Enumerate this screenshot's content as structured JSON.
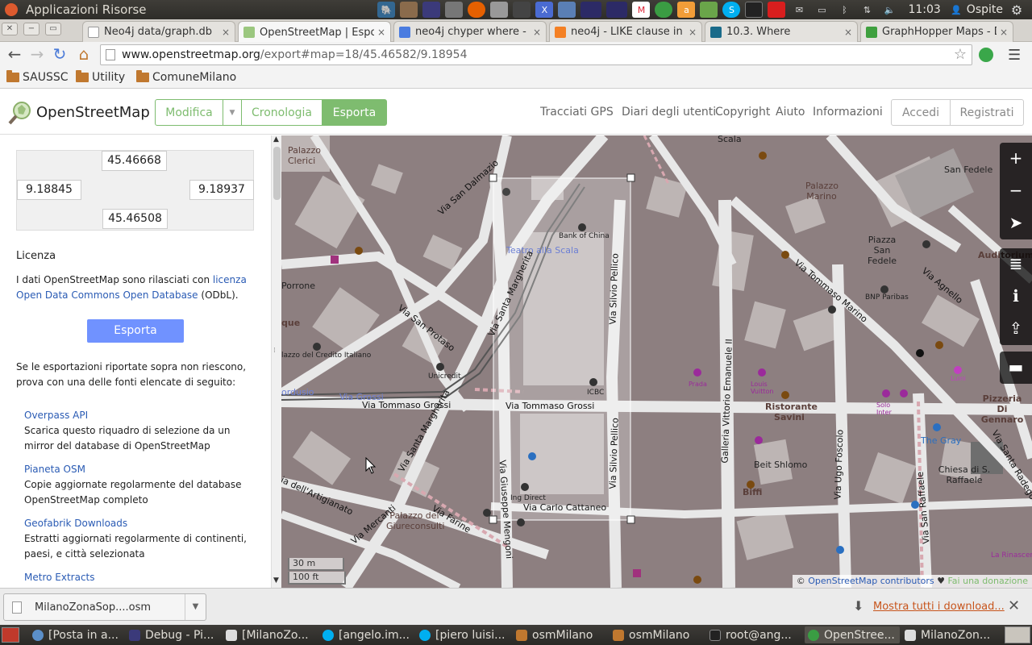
{
  "system_panel": {
    "title": "Applicazioni  Risorse",
    "clock": "11:03",
    "user": "Ospite"
  },
  "tabs": [
    {
      "label": "Neo4j data/graph.db",
      "close": "×"
    },
    {
      "label": "OpenStreetMap | Esporta",
      "close": "×"
    },
    {
      "label": "neo4j chyper where - Cer",
      "close": "×"
    },
    {
      "label": "neo4j - LIKE clause in CYP",
      "close": "×"
    },
    {
      "label": "10.3. Where",
      "close": "×"
    },
    {
      "label": "GraphHopper Maps - Drive",
      "close": "×"
    }
  ],
  "address": {
    "host": "www.openstreetmap.org",
    "path": "/export#map=18/45.46582/9.18954"
  },
  "bookmarks": [
    "SAUSSC",
    "Utility",
    "ComuneMilano"
  ],
  "osm": {
    "brand": "OpenStreetMap",
    "edit": "Modifica",
    "history": "Cronologia",
    "export": "Esporta",
    "links": [
      "Tracciati GPS",
      "Diari degli utenti",
      "Copyright",
      "Aiuto",
      "Informazioni"
    ],
    "login": "Accedi",
    "signup": "Registrati"
  },
  "sidebar": {
    "top": "45.46668",
    "left": "9.18845",
    "right": "9.18937",
    "bottom": "45.46508",
    "license_heading": "Licenza",
    "license_text_pre": "I dati OpenStreetMap sono rilasciati con ",
    "license_link": "licenza Open Data Commons Open Database",
    "license_text_post": " (ODbL).",
    "export_button": "Esporta",
    "fallback_text": "Se le esportazioni riportate sopra non riescono, prova con una delle fonti elencate di seguito:",
    "sources": [
      {
        "name": "Overpass API",
        "desc": "Scarica questo riquadro di selezione da un mirror del database di OpenStreetMap"
      },
      {
        "name": "Pianeta OSM",
        "desc": "Copie aggiornate regolarmente del database OpenStreetMap completo"
      },
      {
        "name": "Geofabrik Downloads",
        "desc": "Estratti aggiornati regolarmente di continenti, paesi, e città selezionata"
      },
      {
        "name": "Metro Extracts",
        "desc": ""
      }
    ]
  },
  "map": {
    "labels": {
      "scala": "Scala",
      "palazzo_clerici": "Palazzo Clerici",
      "san_fedele": "San Fedele",
      "palazzo_marino": "Palazzo Marino",
      "piazza_san_fedele": "Piazza San Fedele",
      "bank_of_china": "Bank of China",
      "teatro": "Teatro alla Scala",
      "auditorium": "Auditorium San",
      "bnp": "BNP Paribas",
      "credito": "lazzo del Credito Italiano",
      "unicredit": "Unicredit",
      "icbc": "ICBC",
      "prada": "Prada",
      "louis_vuitton": "Louis Vuitton",
      "ristorante": "Ristorante Savini",
      "pizzeria": "Pizzeria Di Gennaro",
      "luini": "Luini",
      "solo_inter": "Solo Inter",
      "the_gray": "The Gray",
      "beit_shlomo": "Beit Shlomo",
      "biffi": "Biffi",
      "chiesa": "Chiesa di S. Raffaele",
      "ing_direct": "Ing Direct",
      "giureconsulti": "Palazzo dei Giureconsulti",
      "rinascente": "La Rinascente",
      "que": "que",
      "orrone": "Porrone",
      "cordusio": "ordusio",
      "via_grossi_blue": "Via Grossi"
    },
    "roads": {
      "via_san_dalmazio": "Via San Dalmazio",
      "via_santa_margherita": "Via Santa Margherita",
      "via_silvio_pellico": "Via Silvio Pellico",
      "via_tommaso_grossi": "Via Tommaso Grossi",
      "via_tommaso_marino": "Via Tommaso Marino",
      "via_agnello": "Via Agnello",
      "via_san_protaso": "Via San Protaso",
      "via_giuseppe_mengoni": "Via Giuseppe Mengoni",
      "via_carlo_cattaneo": "Via Carlo Cattaneo",
      "galleria": "Galleria Vittorio Emanuele II",
      "via_ugo_foscolo": "Via Ugo Foscolo",
      "via_san_raffaele": "Via San Raffaele",
      "via_mercanti": "Via Mercanti",
      "via_farine": "Via Farine",
      "via_artigianato": "ia dell'Artigianato",
      "via_san_radegonda": "Via Santa Radego"
    },
    "scale_m": "30 m",
    "scale_ft": "100 ft",
    "attribution_pre": "© ",
    "attribution_link": "OpenStreetMap contributors",
    "attribution_heart": " ♥ ",
    "attribution_donate": "Fai una donazione",
    "controls": [
      "+",
      "−",
      "➤",
      "≣",
      "ℹ",
      "⇪",
      "▬"
    ]
  },
  "downloads": {
    "file": "MilanoZonaSop....osm",
    "show_all": "Mostra tutti i download...",
    "close": "✕"
  },
  "taskbar": [
    {
      "label": "[Posta in a..."
    },
    {
      "label": "Debug - Pi..."
    },
    {
      "label": "[MilanoZo..."
    },
    {
      "label": "[angelo.im..."
    },
    {
      "label": "[piero luisi..."
    },
    {
      "label": "osmMilano"
    },
    {
      "label": "osmMilano"
    },
    {
      "label": "root@ang..."
    },
    {
      "label": "OpenStree..."
    },
    {
      "label": "MilanoZon..."
    }
  ],
  "colors": {
    "osm_green": "#7ebc6f",
    "export_blue": "#7092ff",
    "link_blue": "#2a5bb4",
    "map_bg": "#8d7f80",
    "road": "#e8e8e8",
    "building": "#bdb5b4"
  }
}
